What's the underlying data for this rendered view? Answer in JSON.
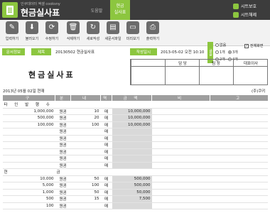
{
  "header": {
    "subtitle": "인쿠데이터 엑셀 cooksny",
    "title": "현금실사표",
    "tab_help": "도움말",
    "tab_active_line1": "현금",
    "tab_active_line2": "실사표",
    "btn_save_sheet": "시트보호",
    "btn_unprotect": "시트해제",
    "accent": "#8cc63f"
  },
  "toolbar": {
    "items": [
      {
        "label": "입력하기",
        "icon": "pencil-icon",
        "glyph": "✎"
      },
      {
        "label": "불러오기",
        "icon": "download-icon",
        "glyph": "⬇"
      },
      {
        "label": "수정하기",
        "icon": "refresh-icon",
        "glyph": "⟳"
      },
      {
        "label": "삭제하기",
        "icon": "trash-icon",
        "glyph": "🗑"
      },
      {
        "label": "새로작성",
        "icon": "new-doc-icon",
        "glyph": "↻"
      },
      {
        "label": "새문서파일",
        "icon": "folder-icon",
        "glyph": "▤"
      },
      {
        "label": "미리보기",
        "icon": "monitor-icon",
        "glyph": "▭"
      },
      {
        "label": "출력하기",
        "icon": "printer-icon",
        "glyph": "⎙"
      }
    ],
    "font_label": "글꼴",
    "font_options": [
      "없음",
      "1개",
      "3개",
      "2개",
      "4개"
    ],
    "font_selected": "3개",
    "fullscreen_label": "전체화면",
    "fullscreen_checked": true
  },
  "info": {
    "label_docinfo": "문서정보",
    "label_title": "제목",
    "title_value": "20130502 현금실사표",
    "label_datetime": "작성일시",
    "datetime_value": "2013-05-02  오전 10:10"
  },
  "document": {
    "title": "현금실사표",
    "approval": [
      "담 당",
      "팀 장",
      "대표이사"
    ],
    "date_line": "2013년 05월 02일 현재",
    "company": "(주)쿠키"
  },
  "table": {
    "headers": [
      "구",
      "분",
      "내",
      "역",
      "금  액",
      "비",
      "고"
    ],
    "rows": [
      {
        "type": "section",
        "c1": "타 인 발 행 수 표",
        "c2": "",
        "c3": "",
        "c4": "",
        "c5": ""
      },
      {
        "type": "data",
        "c1": "1,000,000",
        "c2": "원권",
        "c3": "10",
        "c4": "매",
        "c5": "10,000,000"
      },
      {
        "type": "data",
        "c1": "500,000",
        "c2": "원권",
        "c3": "20",
        "c4": "매",
        "c5": "10,000,000"
      },
      {
        "type": "data",
        "c1": "100,000",
        "c2": "원권",
        "c3": "100",
        "c4": "매",
        "c5": "10,000,000"
      },
      {
        "type": "data",
        "c1": "",
        "c2": "원권",
        "c3": "",
        "c4": "매",
        "c5": ""
      },
      {
        "type": "data",
        "c1": "",
        "c2": "원권",
        "c3": "",
        "c4": "매",
        "c5": ""
      },
      {
        "type": "data",
        "c1": "",
        "c2": "원권",
        "c3": "",
        "c4": "매",
        "c5": ""
      },
      {
        "type": "data",
        "c1": "",
        "c2": "원권",
        "c3": "",
        "c4": "매",
        "c5": ""
      },
      {
        "type": "data",
        "c1": "",
        "c2": "원권",
        "c3": "",
        "c4": "매",
        "c5": ""
      },
      {
        "type": "data",
        "c1": "",
        "c2": "원권",
        "c3": "",
        "c4": "매",
        "c5": ""
      },
      {
        "type": "section",
        "c1": "현",
        "c2": "금",
        "c3": "",
        "c4": "",
        "c5": ""
      },
      {
        "type": "data",
        "c1": "10,000",
        "c2": "원권",
        "c3": "50",
        "c4": "매",
        "c5": "500,000"
      },
      {
        "type": "data",
        "c1": "5,000",
        "c2": "원권",
        "c3": "100",
        "c4": "매",
        "c5": "500,000"
      },
      {
        "type": "data",
        "c1": "1,000",
        "c2": "원권",
        "c3": "50",
        "c4": "매",
        "c5": "50,000"
      },
      {
        "type": "data",
        "c1": "500",
        "c2": "원권",
        "c3": "15",
        "c4": "매",
        "c5": "7,500"
      },
      {
        "type": "data",
        "c1": "100",
        "c2": "원권",
        "c3": "",
        "c4": "매",
        "c5": ""
      }
    ]
  }
}
